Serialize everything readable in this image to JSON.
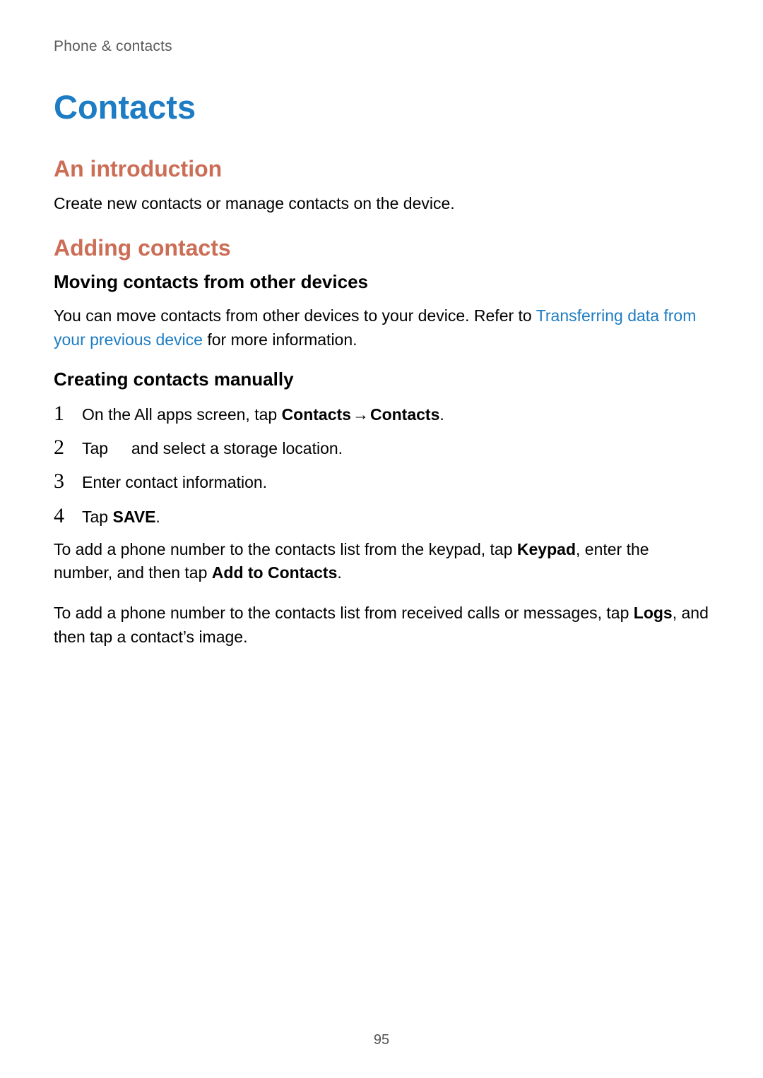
{
  "breadcrumb": "Phone & contacts",
  "title": "Contacts",
  "sections": {
    "intro": {
      "heading": "An introduction",
      "body": "Create new contacts or manage contacts on the device."
    },
    "adding": {
      "heading": "Adding contacts",
      "sub1": {
        "heading": "Moving contacts from other devices",
        "body_pre": "You can move contacts from other devices to your device. Refer to ",
        "link": "Transferring data from your previous device",
        "body_post": " for more information."
      },
      "sub2": {
        "heading": "Creating contacts manually",
        "steps": {
          "s1_pre": "On the All apps screen, tap ",
          "s1_b1": "Contacts",
          "s1_arrow": " → ",
          "s1_b2": "Contacts",
          "s1_post": ".",
          "s2_pre": "Tap ",
          "s2_icon": " ",
          "s2_post": " and select a storage location.",
          "s3": "Enter contact information.",
          "s4_pre": "Tap ",
          "s4_b": "SAVE",
          "s4_post": "."
        },
        "p1_pre": "To add a phone number to the contacts list from the keypad, tap ",
        "p1_b1": "Keypad",
        "p1_mid": ", enter the number, and then tap ",
        "p1_b2": "Add to Contacts",
        "p1_post": ".",
        "p2_pre": "To add a phone number to the contacts list from received calls or messages, tap ",
        "p2_b1": "Logs",
        "p2_post": ", and then tap a contact’s image."
      }
    }
  },
  "nums": {
    "n1": "1",
    "n2": "2",
    "n3": "3",
    "n4": "4"
  },
  "page_number": "95"
}
